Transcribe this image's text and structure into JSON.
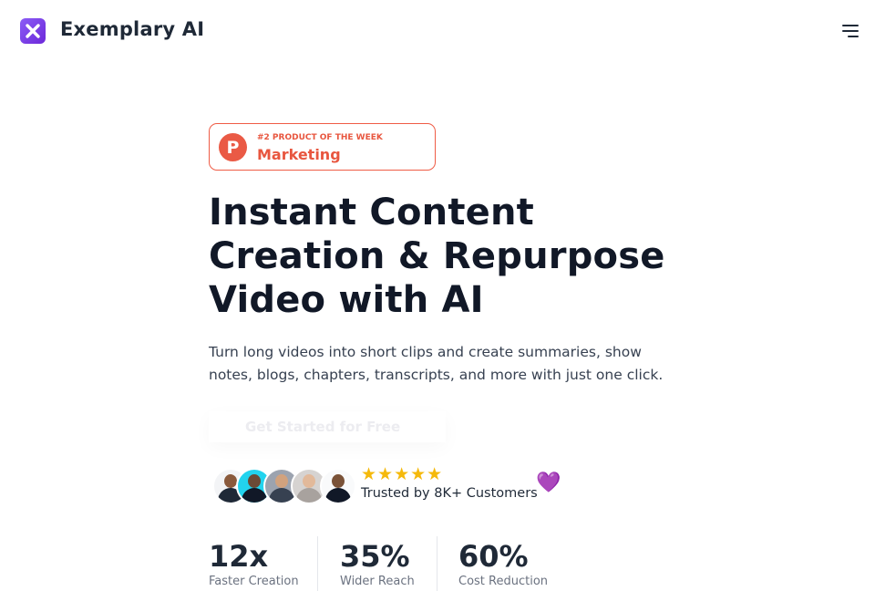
{
  "header": {
    "brand": "Exemplary AI"
  },
  "badge": {
    "letter": "P",
    "kicker": "#2 PRODUCT OF THE WEEK",
    "category": "Marketing"
  },
  "hero": {
    "headline": "Instant Content Creation & Repurpose Video with AI",
    "subtitle": "Turn long videos into short clips and create summaries, show notes, blogs, chapters, transcripts, and more with just one click.",
    "cta": "Get Started for Free"
  },
  "social_proof": {
    "stars": "★★★★★",
    "rating": 5,
    "trusted": "Trusted by 8K+ Customers",
    "heart": "💜"
  },
  "stats": [
    {
      "value": "12x",
      "label": "Faster Creation"
    },
    {
      "value": "35%",
      "label": "Wider Reach"
    },
    {
      "value": "60%",
      "label": "Cost Reduction"
    }
  ],
  "colors": {
    "accent": "#7c3aed",
    "badge": "#ea5a45",
    "star": "#f5b90b"
  }
}
